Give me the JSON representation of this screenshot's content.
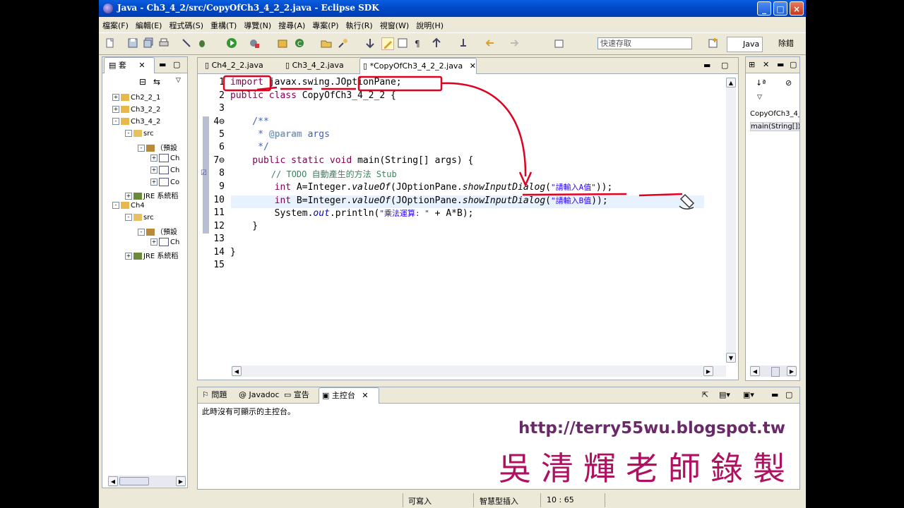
{
  "window": {
    "title": "Java - Ch3_4_2/src/CopyOfCh3_4_2_2.java - Eclipse SDK",
    "minimize": "_",
    "maximize": "□",
    "close": "×"
  },
  "menu": [
    "檔案(F)",
    "編輯(E)",
    "程式碼(S)",
    "重構(T)",
    "導覽(N)",
    "搜尋(A)",
    "專案(P)",
    "執行(R)",
    "視窗(W)",
    "說明(H)"
  ],
  "toolbar": {
    "quick_access_placeholder": "快速存取",
    "perspective_java": "Java",
    "perspective_debug": "除錯"
  },
  "package_explorer": {
    "tab_label": "套",
    "tree": [
      {
        "label": "Ch2_2_1",
        "level": 0,
        "toggle": "+"
      },
      {
        "label": "Ch3_2_2",
        "level": 0,
        "toggle": "+"
      },
      {
        "label": "Ch3_4_2",
        "level": 0,
        "toggle": "-"
      },
      {
        "label": "src",
        "level": 1,
        "toggle": "-"
      },
      {
        "label": "（預設",
        "level": 2,
        "toggle": "-"
      },
      {
        "label": "Ch",
        "level": 3,
        "toggle": "+"
      },
      {
        "label": "Ch",
        "level": 3,
        "toggle": "+"
      },
      {
        "label": "Co",
        "level": 3,
        "toggle": "+"
      },
      {
        "label": "JRE 系統稻",
        "level": 1,
        "toggle": "+"
      },
      {
        "label": "Ch4",
        "level": 0,
        "toggle": "-"
      },
      {
        "label": "src",
        "level": 1,
        "toggle": "-"
      },
      {
        "label": "（預設",
        "level": 2,
        "toggle": "-"
      },
      {
        "label": "Ch",
        "level": 3,
        "toggle": "+"
      },
      {
        "label": "JRE 系統稻",
        "level": 1,
        "toggle": "+"
      }
    ]
  },
  "editor": {
    "tabs": [
      {
        "label": "Ch4_2_2.java"
      },
      {
        "label": "Ch3_4_2.java"
      },
      {
        "label": "*CopyOfCh3_4_2_2.java",
        "active": true
      }
    ],
    "line_numbers": [
      "1",
      "2",
      "3",
      "4⊖",
      "5",
      "6",
      "7⊖",
      "8",
      "9",
      "10",
      "11",
      "12",
      "13",
      "14",
      "15"
    ],
    "code": {
      "l1_kw": "import",
      "l1_rest": " javax.swing.JOptionPane;",
      "l2_kw1": "public",
      "l2_kw2": "class",
      "l2_rest": " CopyOfCh3_4_2_2 {",
      "l4": "    /**",
      "l5_a": "     * ",
      "l5_b": "@param",
      "l5_c": " args",
      "l6": "     */",
      "l7_kw": "    public static void",
      "l7_rest": " main(String[] args) {",
      "l8": "        // TODO 自動產生的方法 Stub",
      "l9_a": "int",
      "l9_b": " A=Integer.",
      "l9_c": "valueOf",
      "l9_d": "(JOptionPane.",
      "l9_e": "showInputDialog",
      "l9_f": "(",
      "l9_g": "\"請輸入A值\"",
      "l9_h": "));",
      "l10_a": "int",
      "l10_b": " B=Integer.",
      "l10_c": "valueOf",
      "l10_d": "(JOptionPane.",
      "l10_e": "showInputDialog",
      "l10_f": "(",
      "l10_g": "\"請輸入B值",
      "l10_h": "));",
      "l11_a": "System.",
      "l11_b": "out",
      "l11_c": ".println(",
      "l11_d": "\"乘法運算: \"",
      "l11_e": " + A*B);",
      "l12": "    }",
      "l14": "}"
    }
  },
  "outline": {
    "items": [
      "CopyOfCh3_4_2_2",
      "main(String[])"
    ]
  },
  "console": {
    "tabs": [
      "問題",
      "Javadoc",
      "宣告",
      "主控台"
    ],
    "message": "此時沒有可顯示的主控台。"
  },
  "status": {
    "writable": "可寫入",
    "insert_mode": "智慧型插入",
    "position": "10 : 65"
  },
  "watermark": {
    "url": "http://terry55wu.blogspot.tw",
    "author": "吳清輝老師錄製"
  },
  "colors": {
    "keyword": "#7f0055",
    "comment": "#3f5fbf",
    "string": "#2a00ff",
    "annotation_red": "#e00020"
  }
}
